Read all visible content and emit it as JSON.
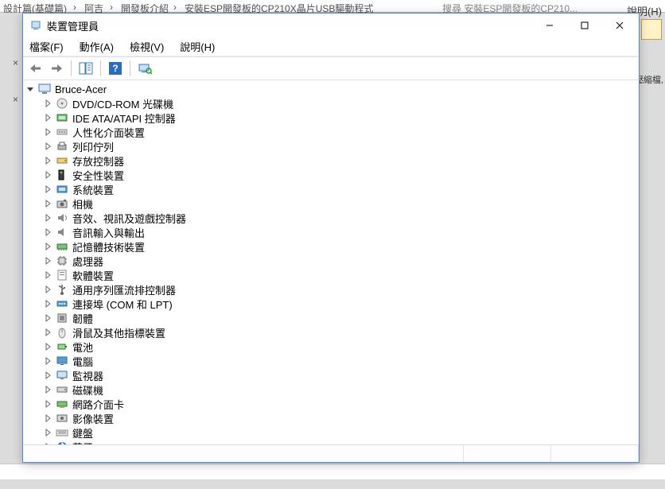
{
  "background": {
    "breadcrumb_fragments": [
      "設計篇(基礎篇)",
      "阿吉",
      "開發板介紹",
      "安裝ESP開發板的CP210X晶片USB驅動程式"
    ],
    "search_placeholder_fragment": "搜尋 安裝ESP開發板的CP210...",
    "help_label": "說明(H)",
    "side_label": "壓縮檔,"
  },
  "window": {
    "title": "裝置管理員"
  },
  "menu": {
    "file": "檔案(F)",
    "action": "動作(A)",
    "view": "檢視(V)",
    "help": "說明(H)"
  },
  "toolbar": {
    "back": "上一步",
    "forward": "下一步",
    "show_hidden": "顯示隱藏",
    "help": "說明",
    "scan": "掃描"
  },
  "tree": {
    "root": "Bruce-Acer",
    "children": [
      {
        "key": "dvd",
        "label": "DVD/CD-ROM 光碟機",
        "icon": "disc"
      },
      {
        "key": "ide",
        "label": "IDE ATA/ATAPI 控制器",
        "icon": "ide"
      },
      {
        "key": "hid",
        "label": "人性化介面裝置",
        "icon": "hid"
      },
      {
        "key": "printq",
        "label": "列印佇列",
        "icon": "printer"
      },
      {
        "key": "storage",
        "label": "存放控制器",
        "icon": "storage"
      },
      {
        "key": "security",
        "label": "安全性裝置",
        "icon": "security"
      },
      {
        "key": "system",
        "label": "系統裝置",
        "icon": "system"
      },
      {
        "key": "camera",
        "label": "相機",
        "icon": "camera"
      },
      {
        "key": "sound",
        "label": "音效、視訊及遊戲控制器",
        "icon": "sound"
      },
      {
        "key": "audioio",
        "label": "音訊輸入與輸出",
        "icon": "audio"
      },
      {
        "key": "memory",
        "label": "記憶體技術裝置",
        "icon": "memory"
      },
      {
        "key": "cpu",
        "label": "處理器",
        "icon": "cpu"
      },
      {
        "key": "software",
        "label": "軟體裝置",
        "icon": "software"
      },
      {
        "key": "usb",
        "label": "通用序列匯流排控制器",
        "icon": "usb"
      },
      {
        "key": "ports",
        "label": "連接埠 (COM 和 LPT)",
        "icon": "port"
      },
      {
        "key": "firmware",
        "label": "韌體",
        "icon": "firmware"
      },
      {
        "key": "mouse",
        "label": "滑鼠及其他指標裝置",
        "icon": "mouse"
      },
      {
        "key": "battery",
        "label": "電池",
        "icon": "battery"
      },
      {
        "key": "computer",
        "label": "電腦",
        "icon": "monitor"
      },
      {
        "key": "monitor",
        "label": "監視器",
        "icon": "monitor2"
      },
      {
        "key": "disk",
        "label": "磁碟機",
        "icon": "disk"
      },
      {
        "key": "network",
        "label": "網路介面卡",
        "icon": "network"
      },
      {
        "key": "imaging",
        "label": "影像裝置",
        "icon": "imaging"
      },
      {
        "key": "keyboard",
        "label": "鍵盤",
        "icon": "keyboard"
      },
      {
        "key": "bluetooth",
        "label": "藍牙",
        "icon": "bluetooth"
      }
    ]
  }
}
